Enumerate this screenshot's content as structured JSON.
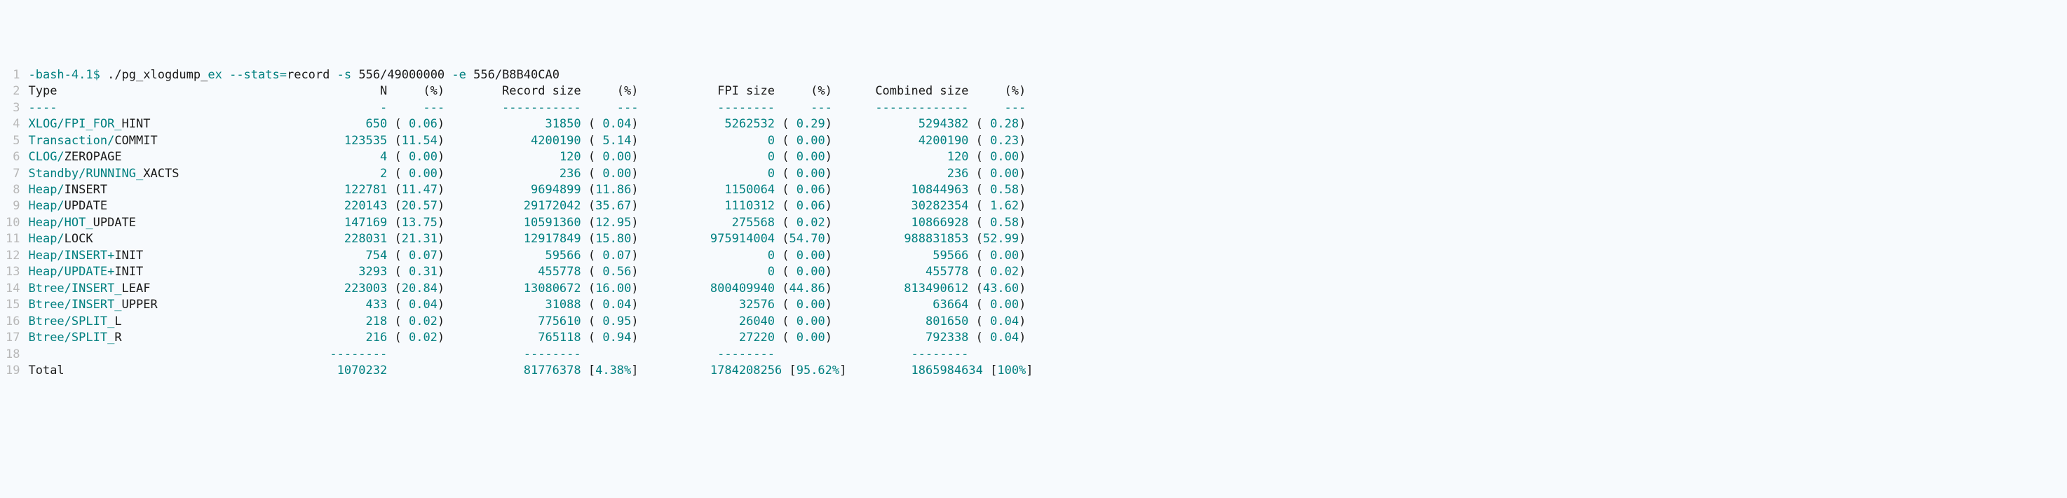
{
  "command": {
    "prompt_prefix": "-bash-4.1$ ",
    "cmd_first": "./pg_xlogdump_",
    "cmd_first_tail": "ex --stats=",
    "cmd_record": "record",
    "cmd_flag_s": " -s ",
    "cmd_s_val": "556/49000000",
    "cmd_flag_e": " -e ",
    "cmd_e_val": "556/B8B40CA0"
  },
  "headers": {
    "type": "Type",
    "n": "N",
    "pct1": "(%)",
    "recsize": "Record size",
    "pct2": "(%)",
    "fpisize": "FPI size",
    "pct3": "(%)",
    "combsize": "Combined size",
    "pct4": "(%)"
  },
  "dashes": {
    "type": "----",
    "n": "-",
    "pct": "---",
    "recsize": "-----------",
    "fpisize": "--------",
    "combsize": "-------------"
  },
  "rows": [
    {
      "t1": "XLOG/FPI_FOR_",
      "t2": "HINT",
      "n": "650",
      "np": "0.06",
      "rs": "31850",
      "rsp": "0.04",
      "fs": "5262532",
      "fsp": "0.29",
      "cs": "5294382",
      "csp": "0.28"
    },
    {
      "t1": "Transaction/",
      "t2": "COMMIT",
      "n": "123535",
      "np": "11.54",
      "rs": "4200190",
      "rsp": "5.14",
      "fs": "0",
      "fsp": "0.00",
      "cs": "4200190",
      "csp": "0.23"
    },
    {
      "t1": "CLOG/",
      "t2": "ZEROPAGE",
      "n": "4",
      "np": "0.00",
      "rs": "120",
      "rsp": "0.00",
      "fs": "0",
      "fsp": "0.00",
      "cs": "120",
      "csp": "0.00"
    },
    {
      "t1": "Standby/RUNNING_",
      "t2": "XACTS",
      "n": "2",
      "np": "0.00",
      "rs": "236",
      "rsp": "0.00",
      "fs": "0",
      "fsp": "0.00",
      "cs": "236",
      "csp": "0.00"
    },
    {
      "t1": "Heap/",
      "t2": "INSERT",
      "n": "122781",
      "np": "11.47",
      "rs": "9694899",
      "rsp": "11.86",
      "fs": "1150064",
      "fsp": "0.06",
      "cs": "10844963",
      "csp": "0.58"
    },
    {
      "t1": "Heap/",
      "t2": "UPDATE",
      "n": "220143",
      "np": "20.57",
      "rs": "29172042",
      "rsp": "35.67",
      "fs": "1110312",
      "fsp": "0.06",
      "cs": "30282354",
      "csp": "1.62"
    },
    {
      "t1": "Heap/HOT_",
      "t2": "UPDATE",
      "n": "147169",
      "np": "13.75",
      "rs": "10591360",
      "rsp": "12.95",
      "fs": "275568",
      "fsp": "0.02",
      "cs": "10866928",
      "csp": "0.58"
    },
    {
      "t1": "Heap/",
      "t2": "LOCK",
      "n": "228031",
      "np": "21.31",
      "rs": "12917849",
      "rsp": "15.80",
      "fs": "975914004",
      "fsp": "54.70",
      "cs": "988831853",
      "csp": "52.99"
    },
    {
      "t1": "Heap/INSERT+",
      "t2": "INIT",
      "n": "754",
      "np": "0.07",
      "rs": "59566",
      "rsp": "0.07",
      "fs": "0",
      "fsp": "0.00",
      "cs": "59566",
      "csp": "0.00"
    },
    {
      "t1": "Heap/UPDATE+",
      "t2": "INIT",
      "n": "3293",
      "np": "0.31",
      "rs": "455778",
      "rsp": "0.56",
      "fs": "0",
      "fsp": "0.00",
      "cs": "455778",
      "csp": "0.02"
    },
    {
      "t1": "Btree/INSERT_",
      "t2": "LEAF",
      "n": "223003",
      "np": "20.84",
      "rs": "13080672",
      "rsp": "16.00",
      "fs": "800409940",
      "fsp": "44.86",
      "cs": "813490612",
      "csp": "43.60"
    },
    {
      "t1": "Btree/INSERT_",
      "t2": "UPPER",
      "n": "433",
      "np": "0.04",
      "rs": "31088",
      "rsp": "0.04",
      "fs": "32576",
      "fsp": "0.00",
      "cs": "63664",
      "csp": "0.00"
    },
    {
      "t1": "Btree/SPLIT_",
      "t2": "L",
      "n": "218",
      "np": "0.02",
      "rs": "775610",
      "rsp": "0.95",
      "fs": "26040",
      "fsp": "0.00",
      "cs": "801650",
      "csp": "0.04"
    },
    {
      "t1": "Btree/SPLIT_",
      "t2": "R",
      "n": "216",
      "np": "0.02",
      "rs": "765118",
      "rsp": "0.94",
      "fs": "27220",
      "fsp": "0.00",
      "cs": "792338",
      "csp": "0.04"
    }
  ],
  "total_dashes": "--------",
  "total": {
    "label": "Total",
    "n": "1070232",
    "rs": "81776378",
    "rsp": "4.38%",
    "fs": "1784208256",
    "fsp": "95.62%",
    "cs": "1865984634",
    "csp": "100%"
  }
}
